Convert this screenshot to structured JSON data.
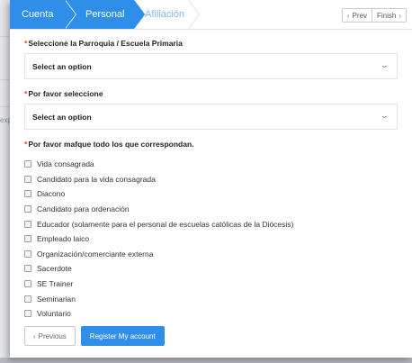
{
  "background": {
    "partial_text": "exp"
  },
  "wizard": {
    "steps": [
      {
        "label": "Cuenta",
        "state": "done"
      },
      {
        "label": "Personal",
        "state": "active"
      },
      {
        "label": "Afiliación",
        "state": "pending"
      }
    ],
    "prev_label": "Prev",
    "finish_label": "Finish",
    "colors": {
      "accent": "#2f8fe8",
      "pending_text": "#7fb7ec"
    }
  },
  "form": {
    "required_mark": "*",
    "parroquia": {
      "label": "Seleccione la Parroquia / Escuela Primaria",
      "value": "Select an option"
    },
    "seleccione": {
      "label": "Por favor seleccione",
      "value": "Select an option"
    },
    "roles": {
      "label": "Por favor mafque todo los que correspondan.",
      "options": [
        "Vida consagrada",
        "Candidato para la vida consagrada",
        "Diacono",
        "Candidato para ordenación",
        "Educador (solamente para el personal de escuelas católicas de la Diócesis)",
        "Empleado laico",
        "Organización/comerciante externa",
        "Sacerdote",
        "SE Trainer",
        "Seminarian",
        "Voluntario"
      ]
    }
  },
  "actions": {
    "previous_label": "Previous",
    "register_label": "Register My account"
  }
}
